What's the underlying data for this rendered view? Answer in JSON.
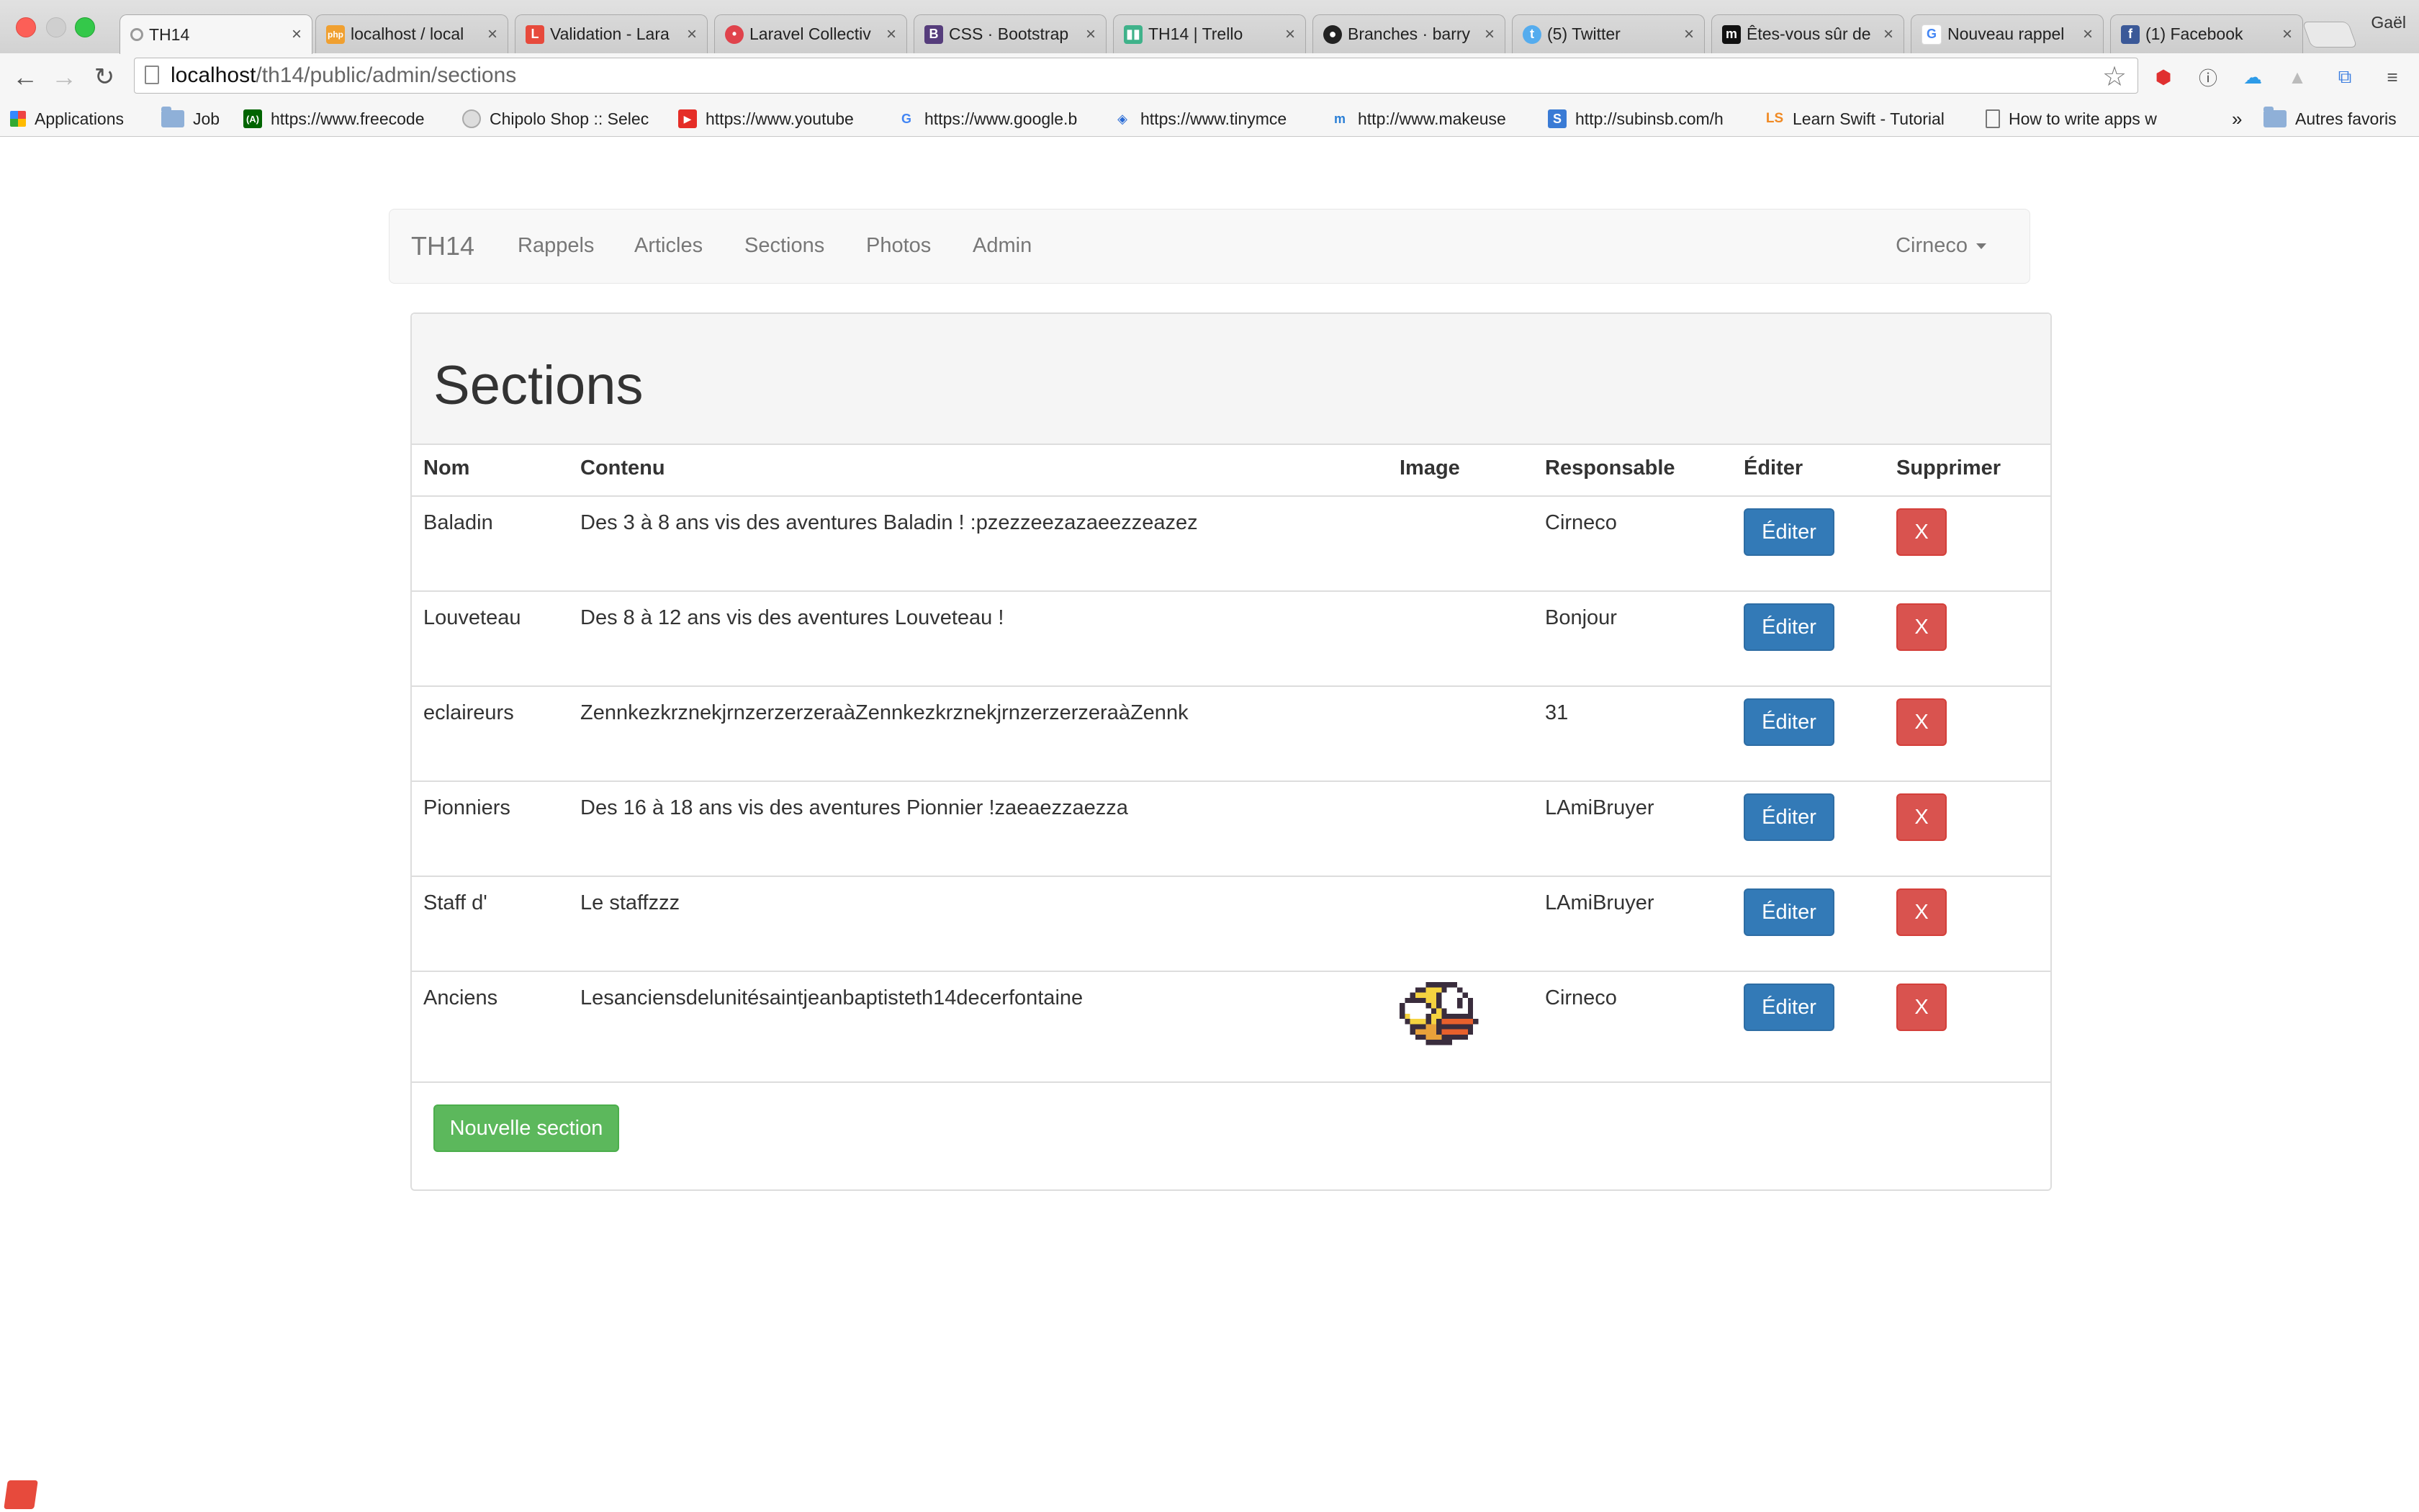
{
  "browser": {
    "profile": "Gaël",
    "tabs": [
      {
        "label": "TH14",
        "icon": "loading-icon",
        "active": true
      },
      {
        "label": "localhost / local",
        "icon": "phpmyadmin-icon"
      },
      {
        "label": "Validation - Lara",
        "icon": "laravel-icon"
      },
      {
        "label": "Laravel Collectiv",
        "icon": "laravel-collective-icon"
      },
      {
        "label": "CSS · Bootstrap",
        "icon": "bootstrap-icon"
      },
      {
        "label": "TH14 | Trello",
        "icon": "trello-icon"
      },
      {
        "label": "Branches · barry",
        "icon": "github-icon"
      },
      {
        "label": "(5) Twitter",
        "icon": "twitter-icon"
      },
      {
        "label": "Êtes-vous sûr de",
        "icon": "medium-icon"
      },
      {
        "label": "Nouveau rappel",
        "icon": "google-icon"
      },
      {
        "label": "(1) Facebook",
        "icon": "facebook-icon"
      }
    ],
    "url_host": "localhost",
    "url_path": "/th14/public/admin/sections",
    "bookmarks": [
      {
        "label": "Applications",
        "icon": "apps-grid-icon"
      },
      {
        "label": "Job",
        "icon": "folder-icon"
      },
      {
        "label": "https://www.freecode",
        "icon": "freecodecamp-icon"
      },
      {
        "label": "Chipolo Shop :: Selec",
        "icon": "chipolo-icon"
      },
      {
        "label": "https://www.youtube",
        "icon": "youtube-icon"
      },
      {
        "label": "https://www.google.b",
        "icon": "google-icon"
      },
      {
        "label": "https://www.tinymce",
        "icon": "tinymce-icon"
      },
      {
        "label": "http://www.makeuse",
        "icon": "makeuseof-icon"
      },
      {
        "label": "http://subinsb.com/h",
        "icon": "subinsb-icon"
      },
      {
        "label": "Learn Swift - Tutorial",
        "icon": "ls-icon"
      },
      {
        "label": "How to write apps w",
        "icon": "page-icon"
      }
    ],
    "bookmarks_more": "»",
    "other_bookmarks": "Autres favoris"
  },
  "navbar": {
    "brand": "TH14",
    "links": [
      "Rappels",
      "Articles",
      "Sections",
      "Photos",
      "Admin"
    ],
    "user": "Cirneco"
  },
  "panel": {
    "title": "Sections",
    "columns": [
      "Nom",
      "Contenu",
      "Image",
      "Responsable",
      "Éditer",
      "Supprimer"
    ],
    "rows": [
      {
        "nom": "Baladin",
        "contenu": "Des 3 à 8 ans vis des aventures Baladin ! :pzezzeezazaeezzeazez",
        "image": "",
        "responsable": "Cirneco",
        "edit": "Éditer",
        "delete": "X"
      },
      {
        "nom": "Louveteau",
        "contenu": "Des 8 à 12 ans vis des aventures Louveteau !",
        "image": "",
        "responsable": "Bonjour",
        "edit": "Éditer",
        "delete": "X"
      },
      {
        "nom": "eclaireurs",
        "contenu": "ZennkezkrznekjrnzerzerzeraàZennkezkrznekjrnzerzerzeraàZennk",
        "image": "",
        "responsable": "31",
        "edit": "Éditer",
        "delete": "X"
      },
      {
        "nom": "Pionniers",
        "contenu": "Des 16 à 18 ans vis des aventures Pionnier !zaeaezzaezza",
        "image": "",
        "responsable": "LAmiBruyer",
        "edit": "Éditer",
        "delete": "X"
      },
      {
        "nom": "Staff d'",
        "contenu": "Le staffzzz",
        "image": "",
        "responsable": "LAmiBruyer",
        "edit": "Éditer",
        "delete": "X"
      },
      {
        "nom": "Anciens",
        "contenu": "Lesanciensdelunitésaintjeanbaptisteth14decerfontaine",
        "image": "flappy-bird-icon",
        "responsable": "Cirneco",
        "edit": "Éditer",
        "delete": "X"
      }
    ],
    "new_button": "Nouvelle section"
  },
  "colors": {
    "primary": "#337ab7",
    "danger": "#d9534f",
    "success": "#5cb85c"
  }
}
